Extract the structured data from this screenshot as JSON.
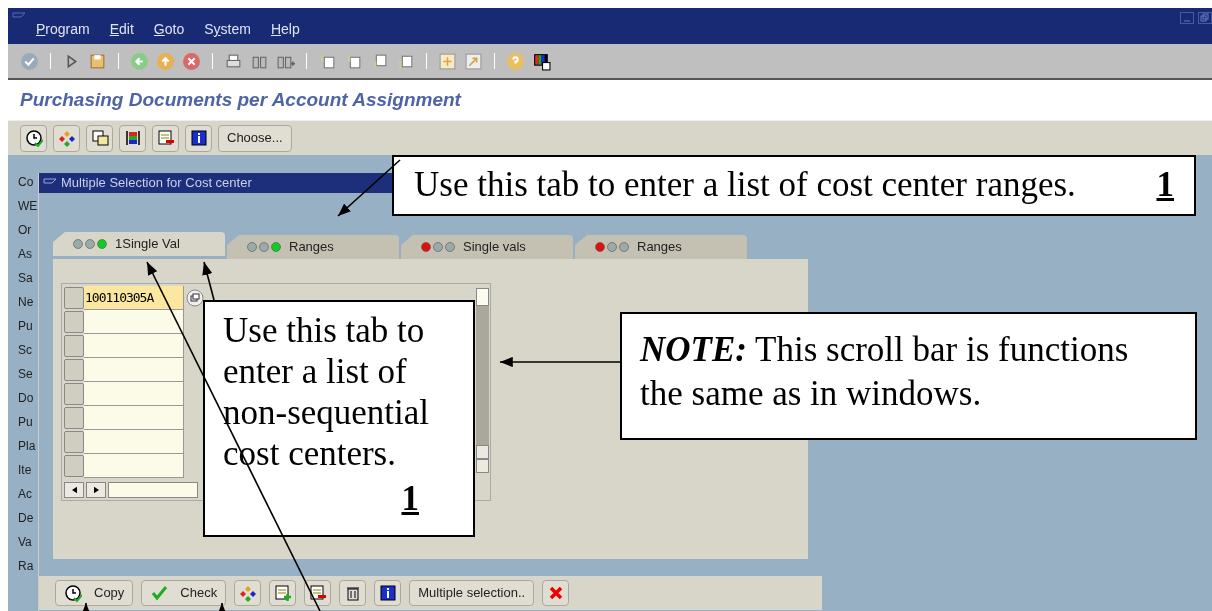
{
  "window": {
    "menu": [
      {
        "key": "P",
        "rest": "rogram"
      },
      {
        "key": "E",
        "rest": "dit"
      },
      {
        "key": "G",
        "rest": "oto"
      },
      {
        "lead": "S",
        "key": "y",
        "rest": "stem"
      },
      {
        "key": "H",
        "rest": "elp"
      }
    ]
  },
  "page_title": "Purchasing Documents per Account Assignment",
  "app_toolbar": {
    "choose_button": "Choose..."
  },
  "field_labels": [
    "Co",
    "WE",
    "Or",
    "As",
    "Sa",
    "Ne",
    "Pu",
    "Sc",
    "Se",
    "Do",
    "Pu",
    "Pla",
    "Ite",
    "Ac",
    "De",
    "Va",
    "Ra"
  ],
  "dialog": {
    "title": "Multiple Selection for Cost center",
    "tabs": [
      {
        "label": "1Single Val",
        "kind": "include",
        "selected": true
      },
      {
        "label": "Ranges",
        "kind": "include",
        "selected": false
      },
      {
        "label": "Single vals",
        "kind": "exclude",
        "selected": false
      },
      {
        "label": "Ranges",
        "kind": "exclude",
        "selected": false
      }
    ],
    "rows": [
      {
        "value": "100110305A",
        "highlighted": true
      },
      {
        "highlighted": false
      },
      {
        "highlighted": false
      },
      {
        "highlighted": false
      },
      {
        "highlighted": false
      },
      {
        "highlighted": false
      },
      {
        "highlighted": false
      },
      {
        "highlighted": false
      }
    ],
    "buttons": [
      {
        "kind": "labeled",
        "label": "Copy"
      },
      {
        "kind": "labeled",
        "label": "Check"
      },
      {
        "kind": "icon"
      },
      {
        "kind": "icon"
      },
      {
        "kind": "icon"
      },
      {
        "kind": "icon"
      },
      {
        "kind": "icon"
      },
      {
        "kind": "labeled",
        "label": "Multiple selection.."
      },
      {
        "kind": "icon"
      }
    ]
  },
  "callouts": [
    {
      "text": "Use this tab to enter a list of cost center ranges.",
      "number": "1"
    },
    {
      "text": "Use this tab to enter a list of non-sequential cost centers.",
      "number": "1"
    },
    {
      "note_label": "NOTE:",
      "text": "This scroll bar is functions the same as in windows."
    }
  ]
}
